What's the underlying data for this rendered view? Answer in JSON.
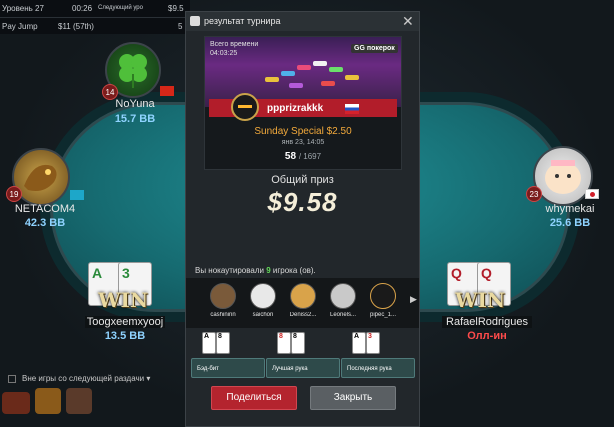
{
  "topbar": {
    "level_label": "Уровень 27",
    "timer": "00:26",
    "next_label": "Следующий уро",
    "next_value": "$9.5",
    "game_label": "Pay Jump",
    "game_value": "$11 (57th)",
    "game_extra": "5"
  },
  "seats": [
    {
      "name": "NoYuna",
      "stack": "15.7 BB",
      "level": "14"
    },
    {
      "name": "NETACOM4",
      "stack": "42.3 BB",
      "level": "19"
    },
    {
      "name": "whymekai",
      "stack": "25.6 BB",
      "level": "23"
    },
    {
      "name": "Toogxeemxyooj",
      "stack": "13.5 BB",
      "win": "WIN",
      "cards": [
        "A",
        "3"
      ]
    },
    {
      "name": "RafaelRodrigues",
      "stack": "Олл-ин",
      "win": "WIN",
      "cards": [
        "Q",
        "Q"
      ]
    }
  ],
  "sitout_label": "Вне игры со следующей раздачи",
  "colors": {
    "accent": "#b4242e",
    "allin": "#ff4b4b",
    "stack": "#8fd3ff",
    "knockout_count": "#63d85a"
  },
  "modal": {
    "title": "результат турнира",
    "banner": {
      "time_label": "Всего времени",
      "time_value": "04:03:25",
      "logo": "GG покерок",
      "player_name": "ppprizrakkk",
      "event": "Sunday Special $2.50",
      "date": "янв 23, 14:05",
      "place": "58",
      "total": "/ 1697"
    },
    "prize_label": "Общий приз",
    "prize_value": "$9.58",
    "knockouts": {
      "prefix": "Вы нокаутировали ",
      "count": "9",
      "suffix": " игрока (ов).",
      "players": [
        "cashininn",
        "saichon",
        "Deniss2...",
        "Leonels...",
        "pipec_1..."
      ]
    },
    "hands": [
      {
        "label": "Бэд-бит",
        "cards": [
          "A",
          "8"
        ]
      },
      {
        "label": "Лучшая рука",
        "cards": [
          "8",
          "8"
        ]
      },
      {
        "label": "Последняя рука",
        "cards": [
          "A",
          "3"
        ]
      }
    ],
    "share_label": "Поделиться",
    "close_label": "Закрыть"
  }
}
